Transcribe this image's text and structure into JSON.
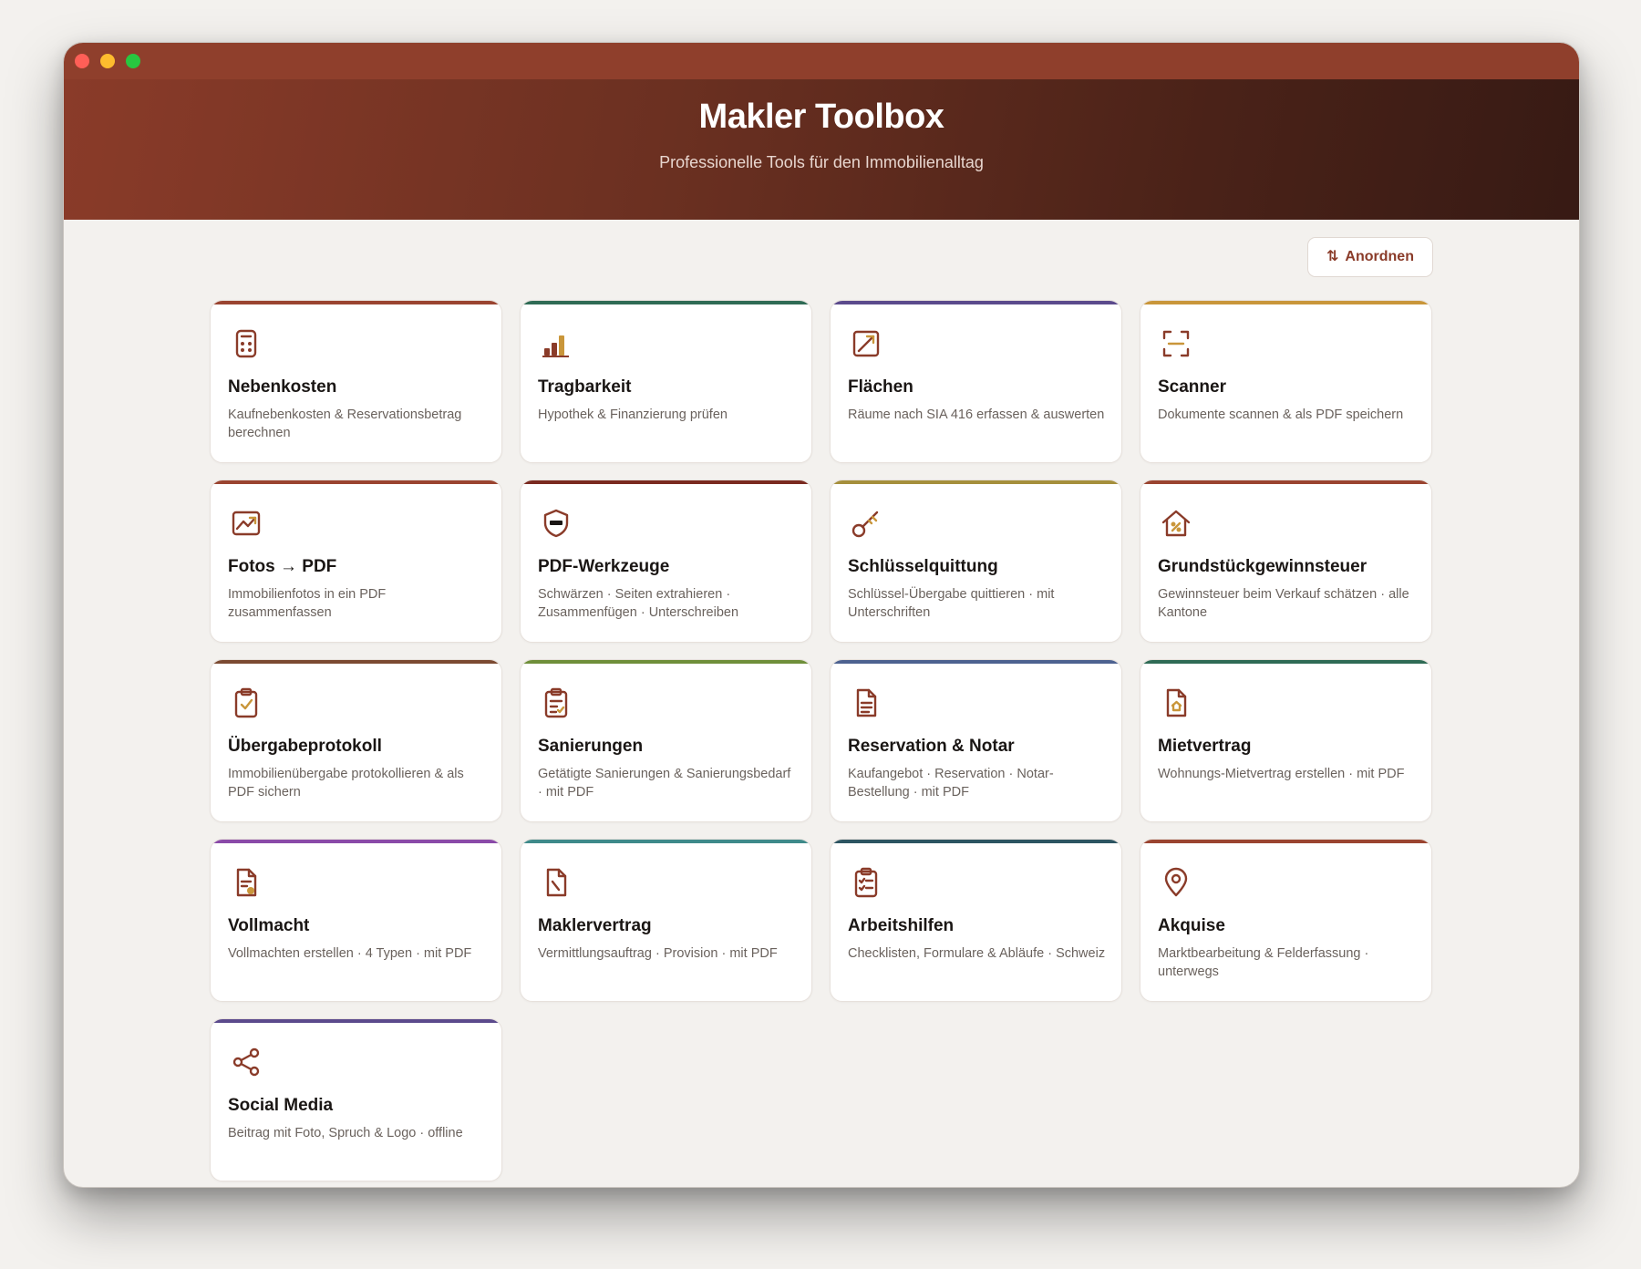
{
  "window": {
    "controls": [
      "close",
      "minimize",
      "zoom"
    ]
  },
  "header": {
    "title": "Makler Toolbox",
    "subtitle": "Professionelle Tools für den Immobilienalltag"
  },
  "toolbar": {
    "sort_icon": "⇅",
    "sort_label": "Anordnen"
  },
  "colors": {
    "brand": "#8f3f2c",
    "brand_dark": "#371a14",
    "icon": "#8a3b29",
    "icon_accent": "#c9963a"
  },
  "tools": [
    {
      "title": "Nebenkosten",
      "description": "Kaufnebenkosten & Reservationsbetrag berechnen",
      "icon": "calculator-icon",
      "accent": "#9a4430"
    },
    {
      "title": "Tragbarkeit",
      "description": "Hypothek & Finanzierung prüfen",
      "icon": "bar-chart-icon",
      "accent": "#2f6b55"
    },
    {
      "title": "Flächen",
      "description": "Räume nach SIA 416 erfassen & auswerten",
      "icon": "area-icon",
      "accent": "#5b4a8c"
    },
    {
      "title": "Scanner",
      "description": "Dokumente scannen & als PDF speichern",
      "icon": "scan-icon",
      "accent": "#c9963a"
    },
    {
      "title": "Fotos → PDF",
      "description": "Immobilienfotos in ein PDF zusammenfassen",
      "icon": "image-icon",
      "accent": "#9a4430"
    },
    {
      "title": "PDF-Werkzeuge",
      "description": "Schwärzen · Seiten extrahieren · Zusammenfügen · Unterschreiben",
      "icon": "shield-icon",
      "accent": "#7a2a20"
    },
    {
      "title": "Schlüsselquittung",
      "description": "Schlüssel-Übergabe quittieren · mit Unterschriften",
      "icon": "key-icon",
      "accent": "#a58f3c"
    },
    {
      "title": "Grundstückgewinnsteuer",
      "description": "Gewinnsteuer beim Verkauf schätzen · alle Kantone",
      "icon": "house-percent-icon",
      "accent": "#9a4430"
    },
    {
      "title": "Übergabeprotokoll",
      "description": "Immobilienübergabe protokollieren & als PDF sichern",
      "icon": "clipboard-check-icon",
      "accent": "#7b4a32"
    },
    {
      "title": "Sanierungen",
      "description": "Getätigte Sanierungen & Sanierungsbedarf · mit PDF",
      "icon": "clipboard-list-icon",
      "accent": "#6f8f3a"
    },
    {
      "title": "Reservation & Notar",
      "description": "Kaufangebot · Reservation · Notar-Bestellung · mit PDF",
      "icon": "document-icon",
      "accent": "#4d6290"
    },
    {
      "title": "Mietvertrag",
      "description": "Wohnungs-Mietvertrag erstellen · mit PDF",
      "icon": "document-house-icon",
      "accent": "#2f6b55"
    },
    {
      "title": "Vollmacht",
      "description": "Vollmachten erstellen · 4 Typen · mit PDF",
      "icon": "document-seal-icon",
      "accent": "#8a4aa8"
    },
    {
      "title": "Maklervertrag",
      "description": "Vermittlungsauftrag · Provision · mit PDF",
      "icon": "document-pen-icon",
      "accent": "#3e8a8a"
    },
    {
      "title": "Arbeitshilfen",
      "description": "Checklisten, Formulare & Abläufe · Schweiz",
      "icon": "checklist-icon",
      "accent": "#2d5562"
    },
    {
      "title": "Akquise",
      "description": "Marktbearbeitung & Felderfassung · unterwegs",
      "icon": "map-pin-icon",
      "accent": "#9a4430"
    },
    {
      "title": "Social Media",
      "description": "Beitrag mit Foto, Spruch & Logo · offline",
      "icon": "share-icon",
      "accent": "#5b4a8c"
    }
  ]
}
